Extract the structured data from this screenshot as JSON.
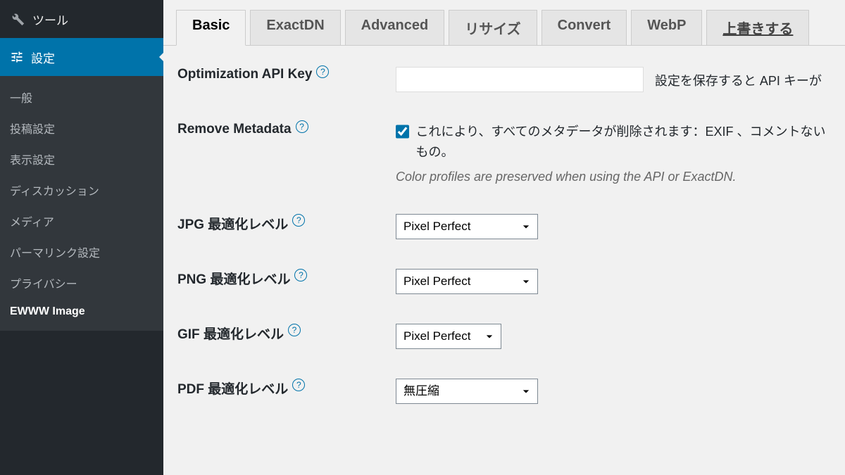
{
  "sidebar": {
    "tools_label": "ツール",
    "settings_label": "設定",
    "items": [
      {
        "label": "一般",
        "active": false
      },
      {
        "label": "投稿設定",
        "active": false
      },
      {
        "label": "表示設定",
        "active": false
      },
      {
        "label": "ディスカッション",
        "active": false
      },
      {
        "label": "メディア",
        "active": false
      },
      {
        "label": "パーマリンク設定",
        "active": false
      },
      {
        "label": "プライバシー",
        "active": false
      },
      {
        "label": "EWWW Image",
        "active": true
      }
    ]
  },
  "tabs": [
    {
      "label": "Basic",
      "active": true
    },
    {
      "label": "ExactDN",
      "active": false
    },
    {
      "label": "Advanced",
      "active": false
    },
    {
      "label": "リサイズ",
      "active": false
    },
    {
      "label": "Convert",
      "active": false
    },
    {
      "label": "WebP",
      "active": false
    },
    {
      "label": "上書きする",
      "active": false,
      "save": true
    }
  ],
  "form": {
    "api_key": {
      "label": "Optimization API Key",
      "value": "",
      "after": "設定を保存すると API キーが"
    },
    "remove_metadata": {
      "label": "Remove Metadata",
      "checked": true,
      "text": "これにより、すべてのメタデータが削除されます：EXIF 、コメントないもの。",
      "note": "Color profiles are preserved when using the API or ExactDN."
    },
    "jpg_level": {
      "label": "JPG 最適化レベル",
      "value": "Pixel Perfect"
    },
    "png_level": {
      "label": "PNG 最適化レベル",
      "value": "Pixel Perfect"
    },
    "gif_level": {
      "label": "GIF 最適化レベル",
      "value": "Pixel Perfect"
    },
    "pdf_level": {
      "label": "PDF 最適化レベル",
      "value": "無圧縮"
    }
  }
}
